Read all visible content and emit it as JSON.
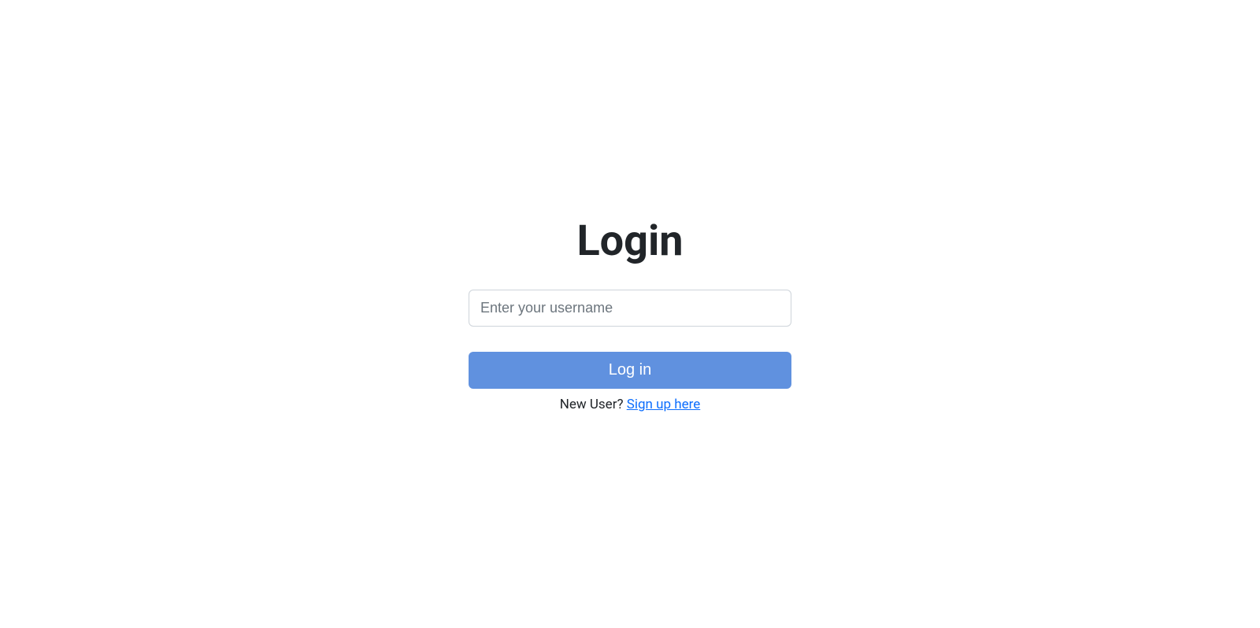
{
  "login": {
    "title": "Login",
    "username_placeholder": "Enter your username",
    "username_value": "",
    "button_label": "Log in",
    "signup_prompt": "New User? ",
    "signup_link": "Sign up here"
  }
}
